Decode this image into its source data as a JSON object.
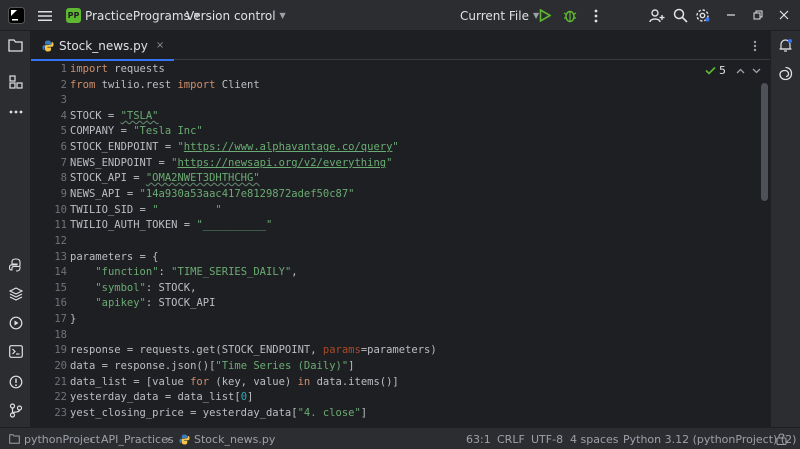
{
  "titlebar": {
    "project_badge": "PP",
    "project_name": "PracticePrograms",
    "vcs_label": "Version control",
    "run_config": "Current File"
  },
  "tab": {
    "label": "Stock_news.py",
    "close": "×"
  },
  "inspection": {
    "count": "5"
  },
  "lines": [
    "1",
    "2",
    "3",
    "4",
    "5",
    "6",
    "7",
    "8",
    "9",
    "10",
    "11",
    "12",
    "13",
    "14",
    "15",
    "16",
    "17",
    "18",
    "19",
    "20",
    "21",
    "22",
    "23"
  ],
  "code": {
    "l1_kw": "import",
    "l1_rest": " requests",
    "l2_kw1": "from",
    "l2_mid": " twilio.rest ",
    "l2_kw2": "import",
    "l2_rest": " Client",
    "l4_a": "STOCK = ",
    "l4_s": "\"TSLA\"",
    "l5_a": "COMPANY = ",
    "l5_s": "\"Tesla Inc\"",
    "l6_a": "STOCK_ENDPOINT = ",
    "l6_q1": "\"",
    "l6_url": "https://www.alphavantage.co/query",
    "l6_q2": "\"",
    "l7_a": "NEWS_ENDPOINT = ",
    "l7_q1": "\"",
    "l7_url": "https://newsapi.org/v2/everything",
    "l7_q2": "\"",
    "l8_a": "STOCK_API = ",
    "l8_s": "\"OMA2NWET3DHTHCHG\"",
    "l9_a": "NEWS_API = ",
    "l9_s": "\"14a930a53aac417e8129872adef50c87\"",
    "l10_a": "TWILIO_SID = ",
    "l10_s": "\"         \"",
    "l11_a": "TWILIO_AUTH_TOKEN = ",
    "l11_s": "\"__________\"",
    "l13": "parameters = {",
    "l14_i": "    ",
    "l14_k": "\"function\"",
    "l14_m": ": ",
    "l14_v": "\"TIME_SERIES_DAILY\"",
    "l14_e": ",",
    "l15_i": "    ",
    "l15_k": "\"symbol\"",
    "l15_m": ": STOCK,",
    "l16_i": "    ",
    "l16_k": "\"apikey\"",
    "l16_m": ": STOCK_API",
    "l17": "}",
    "l19_a": "response = requests.get(STOCK_ENDPOINT, ",
    "l19_p": "params",
    "l19_b": "=parameters)",
    "l20_a": "data = response.json()[",
    "l20_s": "\"Time Series (Daily)\"",
    "l20_b": "]",
    "l21_a": "data_list = [value ",
    "l21_k1": "for",
    "l21_b": " (key, value) ",
    "l21_k2": "in",
    "l21_c": " data.items()]",
    "l22_a": "yesterday_data = data_list[",
    "l22_n": "0",
    "l22_b": "]",
    "l23_a": "yest_closing_price = yesterday_data[",
    "l23_s": "\"4. close\"",
    "l23_b": "]"
  },
  "statusbar": {
    "project": "pythonProject",
    "sep": "›",
    "folder": "API_Practices",
    "file": "Stock_news.py",
    "position": "63:1",
    "line_sep": "CRLF",
    "encoding": "UTF-8",
    "indent": "4 spaces",
    "interpreter": "Python 3.12 (pythonProject) (2)"
  }
}
